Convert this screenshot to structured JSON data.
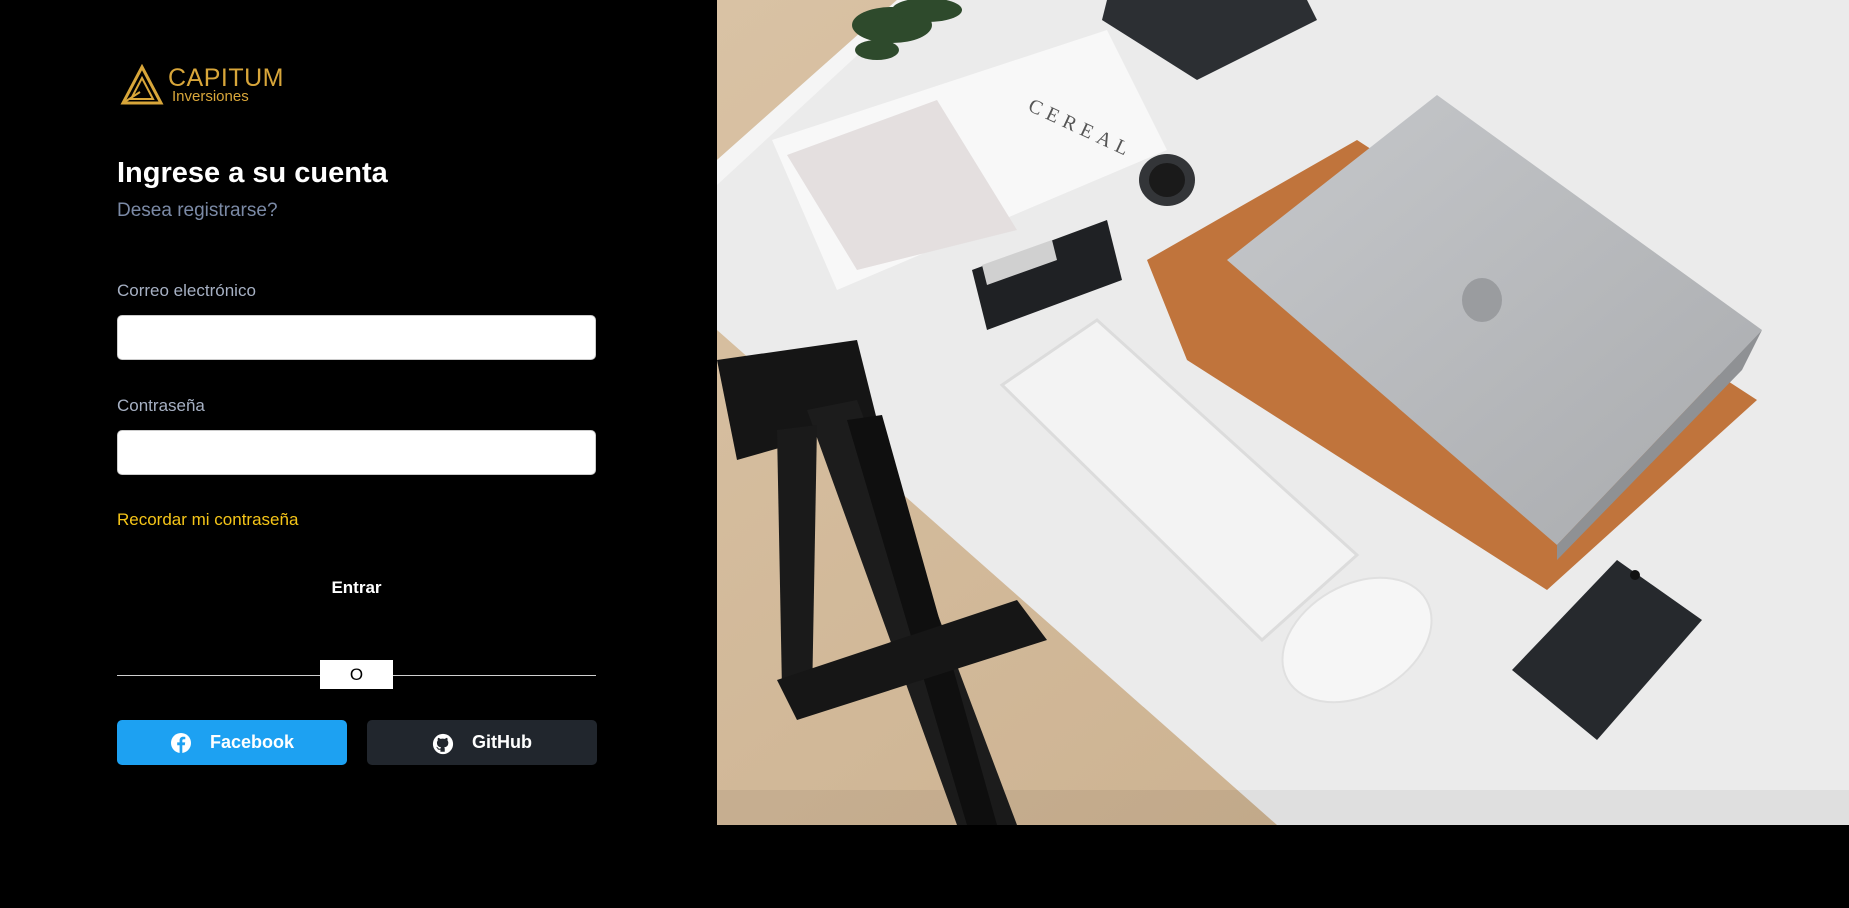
{
  "brand": {
    "name": "CAPITUM",
    "subtitle": "Inversiones",
    "color": "#d8a63a"
  },
  "login": {
    "title": "Ingrese a su cuenta",
    "register_link": "Desea registrarse?",
    "email_label": "Correo electrónico",
    "email_value": "",
    "password_label": "Contraseña",
    "password_value": "",
    "remember_link": "Recordar mi contraseña",
    "submit_label": "Entrar",
    "divider_text": "O"
  },
  "social": {
    "facebook": {
      "label": "Facebook",
      "icon": "facebook-icon",
      "color": "#1da1f2"
    },
    "github": {
      "label": "GitHub",
      "icon": "github-icon",
      "color": "#21262d"
    }
  },
  "colors": {
    "accent": "#f5c518",
    "muted_link": "#7b8aa6",
    "label": "#a6b0c3",
    "background": "#000000"
  }
}
